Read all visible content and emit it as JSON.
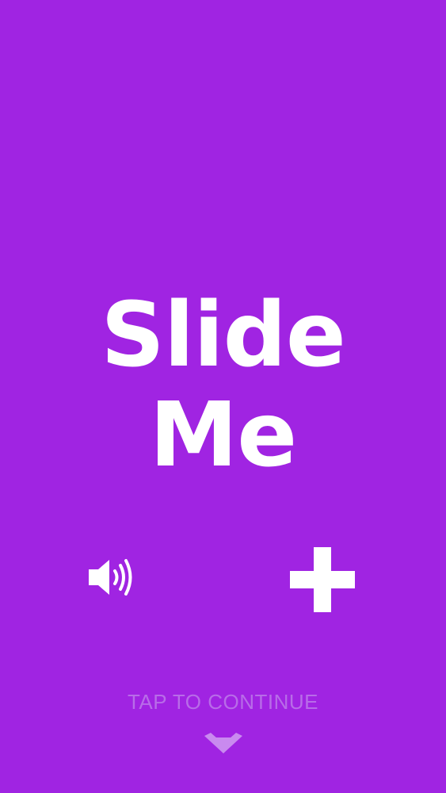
{
  "title": {
    "line1": "Slide",
    "line2": "Me"
  },
  "controls": {
    "sound_icon": "speaker-volume-icon",
    "plus_icon": "plus-icon"
  },
  "footer": {
    "tap_text": "TAP TO CONTINUE",
    "chevron_icon": "chevron-down-icon"
  },
  "colors": {
    "background": "#a024e2",
    "foreground": "#ffffff",
    "muted": "#b86ce8"
  }
}
